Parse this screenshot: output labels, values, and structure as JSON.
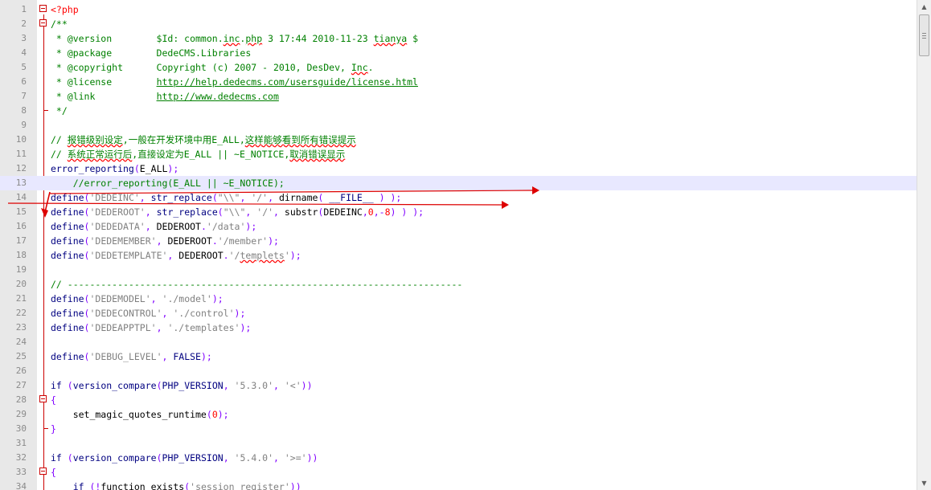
{
  "editor": {
    "lines": [
      {
        "n": "1",
        "t": [
          {
            "c": "php",
            "s": "<?php"
          }
        ],
        "fold": "box"
      },
      {
        "n": "2",
        "t": [
          {
            "c": "cmt",
            "s": "/**"
          }
        ],
        "fold": "box"
      },
      {
        "n": "3",
        "t": [
          {
            "c": "cmt",
            "s": " * @version        $Id: common."
          },
          {
            "c": "cmt sq",
            "s": "inc"
          },
          {
            "c": "cmt",
            "s": "."
          },
          {
            "c": "cmt sq",
            "s": "php"
          },
          {
            "c": "cmt",
            "s": " 3 17:44 2010-11-23 "
          },
          {
            "c": "cmt sq",
            "s": "tianya"
          },
          {
            "c": "cmt",
            "s": " $"
          }
        ]
      },
      {
        "n": "4",
        "t": [
          {
            "c": "cmt",
            "s": " * @package        DedeCMS.Libraries"
          }
        ]
      },
      {
        "n": "5",
        "t": [
          {
            "c": "cmt",
            "s": " * @copyright      Copyright (c) 2007 - 2010, DesDev, "
          },
          {
            "c": "cmt sq",
            "s": "Inc"
          },
          {
            "c": "cmt",
            "s": "."
          }
        ]
      },
      {
        "n": "6",
        "t": [
          {
            "c": "cmt",
            "s": " * @license        "
          },
          {
            "c": "cmt und",
            "s": "http://help.dedecms.com/usersguide/license.html"
          }
        ]
      },
      {
        "n": "7",
        "t": [
          {
            "c": "cmt",
            "s": " * @link           "
          },
          {
            "c": "cmt und",
            "s": "http://www.dedecms.com"
          }
        ]
      },
      {
        "n": "8",
        "t": [
          {
            "c": "cmt",
            "s": " */"
          }
        ],
        "fold": "end"
      },
      {
        "n": "9",
        "t": []
      },
      {
        "n": "10",
        "t": [
          {
            "c": "cmt",
            "s": "// "
          },
          {
            "c": "cmt sq",
            "s": "报错级别设定"
          },
          {
            "c": "cmt",
            "s": ",一般在开发环境中用E_ALL,"
          },
          {
            "c": "cmt sq",
            "s": "这样能够看到所有错误提示"
          }
        ]
      },
      {
        "n": "11",
        "t": [
          {
            "c": "cmt",
            "s": "// "
          },
          {
            "c": "cmt sq",
            "s": "系统正常运行后"
          },
          {
            "c": "cmt",
            "s": ",直接设定为E_ALL || ~E_NOTICE,"
          },
          {
            "c": "cmt sq",
            "s": "取消错误显示"
          }
        ]
      },
      {
        "n": "12",
        "t": [
          {
            "c": "fn",
            "s": "error_reporting"
          },
          {
            "c": "op",
            "s": "("
          },
          {
            "c": "",
            "s": "E_ALL"
          },
          {
            "c": "op",
            "s": ");"
          }
        ]
      },
      {
        "n": "13",
        "t": [
          {
            "c": "cmt",
            "s": "    //error_reporting(E_ALL || ~E_NOTICE);"
          }
        ],
        "hl": true
      },
      {
        "n": "14",
        "t": [
          {
            "c": "fn",
            "s": "define"
          },
          {
            "c": "op",
            "s": "("
          },
          {
            "c": "str",
            "s": "'DEDEINC'"
          },
          {
            "c": "op",
            "s": ", "
          },
          {
            "c": "fn",
            "s": "str_replace"
          },
          {
            "c": "op",
            "s": "("
          },
          {
            "c": "str",
            "s": "\"\\\\\""
          },
          {
            "c": "op",
            "s": ", "
          },
          {
            "c": "str",
            "s": "'/'"
          },
          {
            "c": "op",
            "s": ", "
          },
          {
            "c": "",
            "s": "dirname"
          },
          {
            "c": "op",
            "s": "( "
          },
          {
            "c": "fn",
            "s": "__FILE__"
          },
          {
            "c": "op",
            "s": " ) );"
          }
        ]
      },
      {
        "n": "15",
        "t": [
          {
            "c": "fn",
            "s": "define"
          },
          {
            "c": "op",
            "s": "("
          },
          {
            "c": "str",
            "s": "'DEDEROOT'"
          },
          {
            "c": "op",
            "s": ", "
          },
          {
            "c": "fn",
            "s": "str_replace"
          },
          {
            "c": "op",
            "s": "("
          },
          {
            "c": "str",
            "s": "\"\\\\\""
          },
          {
            "c": "op",
            "s": ", "
          },
          {
            "c": "str",
            "s": "'/'"
          },
          {
            "c": "op",
            "s": ", "
          },
          {
            "c": "",
            "s": "substr"
          },
          {
            "c": "op",
            "s": "("
          },
          {
            "c": "",
            "s": "DEDEINC"
          },
          {
            "c": "op",
            "s": ","
          },
          {
            "c": "num",
            "s": "0"
          },
          {
            "c": "op",
            "s": ",-"
          },
          {
            "c": "num",
            "s": "8"
          },
          {
            "c": "op",
            "s": ") ) );"
          }
        ]
      },
      {
        "n": "16",
        "t": [
          {
            "c": "fn",
            "s": "define"
          },
          {
            "c": "op",
            "s": "("
          },
          {
            "c": "str",
            "s": "'DEDEDATA'"
          },
          {
            "c": "op",
            "s": ", "
          },
          {
            "c": "",
            "s": "DEDEROOT"
          },
          {
            "c": "op",
            "s": "."
          },
          {
            "c": "str",
            "s": "'/data'"
          },
          {
            "c": "op",
            "s": ");"
          }
        ]
      },
      {
        "n": "17",
        "t": [
          {
            "c": "fn",
            "s": "define"
          },
          {
            "c": "op",
            "s": "("
          },
          {
            "c": "str",
            "s": "'DEDEMEMBER'"
          },
          {
            "c": "op",
            "s": ", "
          },
          {
            "c": "",
            "s": "DEDEROOT"
          },
          {
            "c": "op",
            "s": "."
          },
          {
            "c": "str",
            "s": "'/member'"
          },
          {
            "c": "op",
            "s": ");"
          }
        ]
      },
      {
        "n": "18",
        "t": [
          {
            "c": "fn",
            "s": "define"
          },
          {
            "c": "op",
            "s": "("
          },
          {
            "c": "str",
            "s": "'DEDETEMPLATE'"
          },
          {
            "c": "op",
            "s": ", "
          },
          {
            "c": "",
            "s": "DEDEROOT"
          },
          {
            "c": "op",
            "s": "."
          },
          {
            "c": "str",
            "s": "'/"
          },
          {
            "c": "str sq",
            "s": "templets"
          },
          {
            "c": "str",
            "s": "'"
          },
          {
            "c": "op",
            "s": ");"
          }
        ]
      },
      {
        "n": "19",
        "t": []
      },
      {
        "n": "20",
        "t": [
          {
            "c": "cmt",
            "s": "// -----------------------------------------------------------------------"
          }
        ]
      },
      {
        "n": "21",
        "t": [
          {
            "c": "fn",
            "s": "define"
          },
          {
            "c": "op",
            "s": "("
          },
          {
            "c": "str",
            "s": "'DEDEMODEL'"
          },
          {
            "c": "op",
            "s": ", "
          },
          {
            "c": "str",
            "s": "'./model'"
          },
          {
            "c": "op",
            "s": ");"
          }
        ]
      },
      {
        "n": "22",
        "t": [
          {
            "c": "fn",
            "s": "define"
          },
          {
            "c": "op",
            "s": "("
          },
          {
            "c": "str",
            "s": "'DEDECONTROL'"
          },
          {
            "c": "op",
            "s": ", "
          },
          {
            "c": "str",
            "s": "'./control'"
          },
          {
            "c": "op",
            "s": ");"
          }
        ]
      },
      {
        "n": "23",
        "t": [
          {
            "c": "fn",
            "s": "define"
          },
          {
            "c": "op",
            "s": "("
          },
          {
            "c": "str",
            "s": "'DEDEAPPTPL'"
          },
          {
            "c": "op",
            "s": ", "
          },
          {
            "c": "str",
            "s": "'./templates'"
          },
          {
            "c": "op",
            "s": ");"
          }
        ]
      },
      {
        "n": "24",
        "t": []
      },
      {
        "n": "25",
        "t": [
          {
            "c": "fn",
            "s": "define"
          },
          {
            "c": "op",
            "s": "("
          },
          {
            "c": "str",
            "s": "'DEBUG_LEVEL'"
          },
          {
            "c": "op",
            "s": ", "
          },
          {
            "c": "kw",
            "s": "FALSE"
          },
          {
            "c": "op",
            "s": ");"
          }
        ]
      },
      {
        "n": "26",
        "t": []
      },
      {
        "n": "27",
        "t": [
          {
            "c": "kw",
            "s": "if"
          },
          {
            "c": "op",
            "s": " ("
          },
          {
            "c": "fn",
            "s": "version_compare"
          },
          {
            "c": "op",
            "s": "("
          },
          {
            "c": "fn",
            "s": "PHP_VERSION"
          },
          {
            "c": "op",
            "s": ", "
          },
          {
            "c": "str",
            "s": "'5.3.0'"
          },
          {
            "c": "op",
            "s": ", "
          },
          {
            "c": "str",
            "s": "'<'"
          },
          {
            "c": "op",
            "s": "))"
          }
        ]
      },
      {
        "n": "28",
        "t": [
          {
            "c": "op",
            "s": "{"
          }
        ],
        "fold": "box"
      },
      {
        "n": "29",
        "t": [
          {
            "c": "",
            "s": "    set_magic_quotes_runtime"
          },
          {
            "c": "op",
            "s": "("
          },
          {
            "c": "num",
            "s": "0"
          },
          {
            "c": "op",
            "s": ");"
          }
        ]
      },
      {
        "n": "30",
        "t": [
          {
            "c": "op",
            "s": "}"
          }
        ],
        "fold": "end"
      },
      {
        "n": "31",
        "t": []
      },
      {
        "n": "32",
        "t": [
          {
            "c": "kw",
            "s": "if"
          },
          {
            "c": "op",
            "s": " ("
          },
          {
            "c": "fn",
            "s": "version_compare"
          },
          {
            "c": "op",
            "s": "("
          },
          {
            "c": "fn",
            "s": "PHP_VERSION"
          },
          {
            "c": "op",
            "s": ", "
          },
          {
            "c": "str",
            "s": "'5.4.0'"
          },
          {
            "c": "op",
            "s": ", "
          },
          {
            "c": "str",
            "s": "'>='"
          },
          {
            "c": "op",
            "s": "))"
          }
        ]
      },
      {
        "n": "33",
        "t": [
          {
            "c": "op",
            "s": "{"
          }
        ],
        "fold": "box"
      },
      {
        "n": "34",
        "t": [
          {
            "c": "",
            "s": "    "
          },
          {
            "c": "kw",
            "s": "if"
          },
          {
            "c": "op",
            "s": " (!"
          },
          {
            "c": "",
            "s": "function_exists"
          },
          {
            "c": "op",
            "s": "("
          },
          {
            "c": "str",
            "s": "'session_register'"
          },
          {
            "c": "op",
            "s": "))"
          }
        ]
      }
    ]
  },
  "scrollbar": {
    "up_icon": "▲",
    "down_icon": "▼"
  },
  "colors": {
    "annotation": "#dd0000"
  }
}
